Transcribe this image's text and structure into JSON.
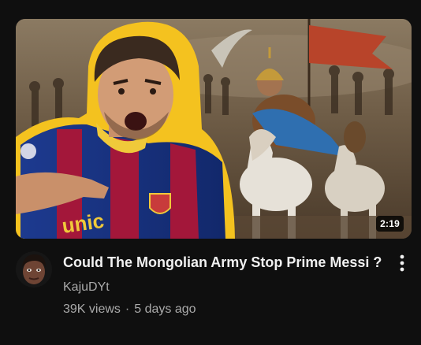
{
  "video": {
    "duration": "2:19",
    "title": "Could The Mongolian Army Stop Prime Messi ?",
    "channel": "KajuDYt",
    "views": "39K views",
    "separator": "·",
    "age": "5 days ago",
    "thumbnail_text": "unic",
    "thumbnail_colors": {
      "sky": "#7a6a56",
      "ground": "#5a4a38",
      "outline": "#f4c21f",
      "jersey_blue": "#1d3a8f",
      "jersey_red": "#a3173a",
      "cape": "#2f6fb0"
    }
  },
  "icons": {
    "more": "more-vert-icon"
  }
}
